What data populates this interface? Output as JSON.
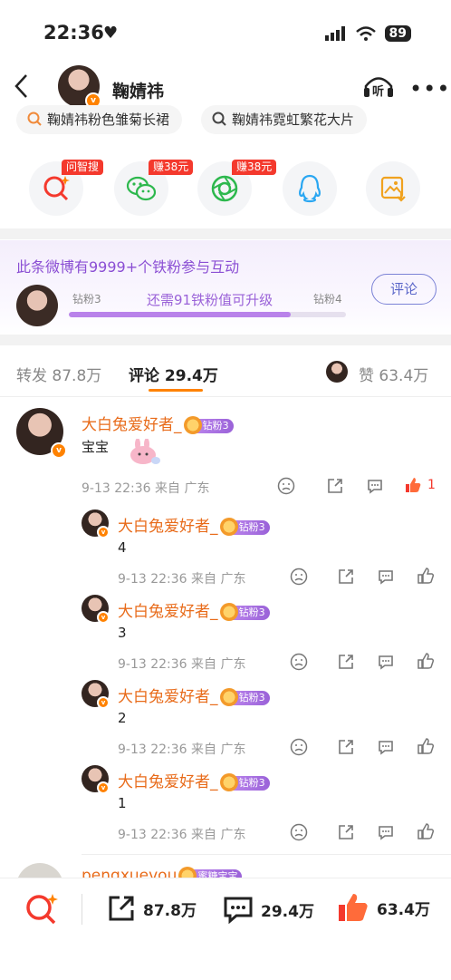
{
  "status": {
    "time": "22:36",
    "battery": "89"
  },
  "header": {
    "name": "鞠婧祎",
    "listen_label": "听"
  },
  "search_pills": [
    "鞠婧祎粉色雏菊长裙",
    "鞠婧祎霓虹繁花大片"
  ],
  "share": {
    "items": [
      {
        "name": "问智搜",
        "tag": "问智搜"
      },
      {
        "name": "wechat",
        "tag": "赚38元"
      },
      {
        "name": "moments",
        "tag": "赚38元"
      },
      {
        "name": "qq",
        "tag": ""
      },
      {
        "name": "save-image",
        "tag": ""
      }
    ]
  },
  "fan": {
    "title": "此条微博有9999+个铁粉参与互动",
    "level_current": "钻粉3",
    "level_next": "钻粉4",
    "progress_text": "还需91铁粉值可升级",
    "progress": 0.8,
    "comment_button": "评论"
  },
  "tabs": {
    "repost": "转发 87.8万",
    "comment": "评论 29.4万",
    "like": "赞 63.4万"
  },
  "comment": {
    "username": "大白兔爱好者_",
    "badge": "钻粉3",
    "text": "宝宝",
    "time": "9-13 22:36",
    "source": "来自 广东",
    "likes": "1"
  },
  "replies": [
    {
      "username": "大白兔爱好者_",
      "badge": "钻粉3",
      "text": "4",
      "time": "9-13 22:36",
      "source": "来自 广东"
    },
    {
      "username": "大白兔爱好者_",
      "badge": "钻粉3",
      "text": "3",
      "time": "9-13 22:36",
      "source": "来自 广东"
    },
    {
      "username": "大白兔爱好者_",
      "badge": "钻粉3",
      "text": "2",
      "time": "9-13 22:36",
      "source": "来自 广东"
    },
    {
      "username": "大白兔爱好者_",
      "badge": "钻粉3",
      "text": "1",
      "time": "9-13 22:36",
      "source": "来自 广东"
    }
  ],
  "next_comment": {
    "username": "pengxuevou",
    "badge": "蜜糖宝宝"
  },
  "bottom": {
    "repost": "87.8万",
    "comment": "29.4万",
    "like": "63.4万"
  },
  "colors": {
    "accent": "#ff8200",
    "username": "#e86b1a",
    "fan_purple": "#9a62d8",
    "like_red": "#f4392d"
  }
}
